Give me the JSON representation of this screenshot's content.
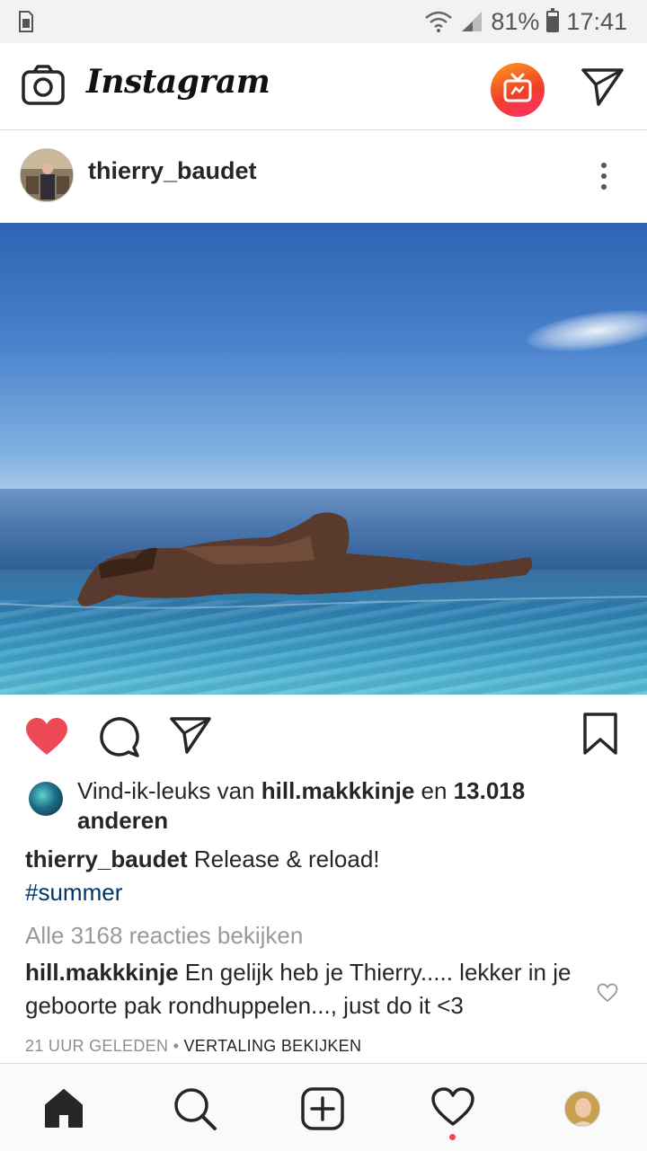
{
  "status_bar": {
    "battery_text": "81%",
    "battery_level": 0.81,
    "time": "17:41"
  },
  "topbar": {
    "logo_text": "Instagram"
  },
  "post": {
    "username": "thierry_baudet",
    "likes": {
      "prefix": "Vind-ik-leuks van",
      "liker": "hill.makkkinje",
      "joiner": "en",
      "count": "13.018",
      "suffix": "anderen"
    },
    "caption": {
      "username": "thierry_baudet",
      "text": "Release & reload!",
      "hashtag": "#summer"
    },
    "view_comments": "Alle 3168 reacties bekijken",
    "comment": {
      "username": "hill.makkkinje",
      "text": "En gelijk heb je Thierry..... lekker in je geboorte pak rondhuppelen..., just do it <3"
    },
    "comment_meta": {
      "time": "21 UUR GELEDEN",
      "separator": "•",
      "translate": "VERTALING BEKIJKEN"
    },
    "liked": true
  },
  "colors": {
    "like_red": "#ed4956",
    "hashtag_blue": "#003569",
    "igtv_orange": "#f0402a"
  }
}
